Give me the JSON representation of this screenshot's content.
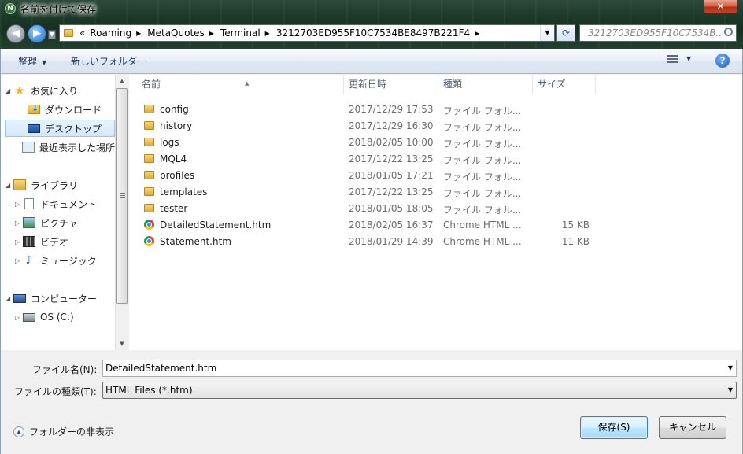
{
  "window": {
    "title": "名前を付けて保存",
    "close_label": "✕"
  },
  "address": {
    "overflow": "«",
    "parts": [
      "Roaming",
      "MetaQuotes",
      "Terminal",
      "3212703ED955F10C7534BE8497B221F4"
    ],
    "search_placeholder": "3212703ED955F10C7534B..."
  },
  "toolbar": {
    "organize": "整理",
    "new_folder": "新しいフォルダー"
  },
  "nav": [
    {
      "label": "お気に入り",
      "icon": "star-icon"
    },
    {
      "label": "ダウンロード",
      "icon": "downloads-folder-icon"
    },
    {
      "label": "デスクトップ",
      "icon": "desktop-icon",
      "selected": true
    },
    {
      "label": "最近表示した場所",
      "icon": "recent-places-icon"
    },
    {
      "label": "ライブラリ",
      "icon": "library-icon"
    },
    {
      "label": "ドキュメント",
      "icon": "documents-icon"
    },
    {
      "label": "ピクチャ",
      "icon": "pictures-icon"
    },
    {
      "label": "ビデオ",
      "icon": "videos-icon"
    },
    {
      "label": "ミュージック",
      "icon": "music-icon"
    },
    {
      "label": "コンピューター",
      "icon": "computer-icon"
    },
    {
      "label": "OS (C:)",
      "icon": "drive-icon"
    }
  ],
  "columns": {
    "name": "名前",
    "date": "更新日時",
    "type": "種類",
    "size": "サイズ"
  },
  "files": [
    {
      "name": "config",
      "date": "2017/12/29 17:53",
      "type": "ファイル フォル...",
      "size": "",
      "icon": "folder-icon"
    },
    {
      "name": "history",
      "date": "2017/12/29 16:30",
      "type": "ファイル フォル...",
      "size": "",
      "icon": "folder-icon"
    },
    {
      "name": "logs",
      "date": "2018/02/05 10:00",
      "type": "ファイル フォル...",
      "size": "",
      "icon": "folder-icon"
    },
    {
      "name": "MQL4",
      "date": "2017/12/22 13:25",
      "type": "ファイル フォル...",
      "size": "",
      "icon": "folder-icon"
    },
    {
      "name": "profiles",
      "date": "2018/01/05 17:21",
      "type": "ファイル フォル...",
      "size": "",
      "icon": "folder-icon"
    },
    {
      "name": "templates",
      "date": "2017/12/22 13:25",
      "type": "ファイル フォル...",
      "size": "",
      "icon": "folder-icon"
    },
    {
      "name": "tester",
      "date": "2018/01/05 18:05",
      "type": "ファイル フォル...",
      "size": "",
      "icon": "folder-icon"
    },
    {
      "name": "DetailedStatement.htm",
      "date": "2018/02/05 16:37",
      "type": "Chrome HTML ...",
      "size": "15 KB",
      "icon": "chrome-icon"
    },
    {
      "name": "Statement.htm",
      "date": "2018/01/29 14:39",
      "type": "Chrome HTML ...",
      "size": "11 KB",
      "icon": "chrome-icon"
    }
  ],
  "form": {
    "filename_label": "ファイル名(N):",
    "filename_value": "DetailedStatement.htm",
    "filetype_label": "ファイルの種類(T):",
    "filetype_value": "HTML Files (*.htm)"
  },
  "footer": {
    "hide_folders": "フォルダーの非表示",
    "save_label": "保存(S)",
    "cancel_label": "キャンセル"
  }
}
